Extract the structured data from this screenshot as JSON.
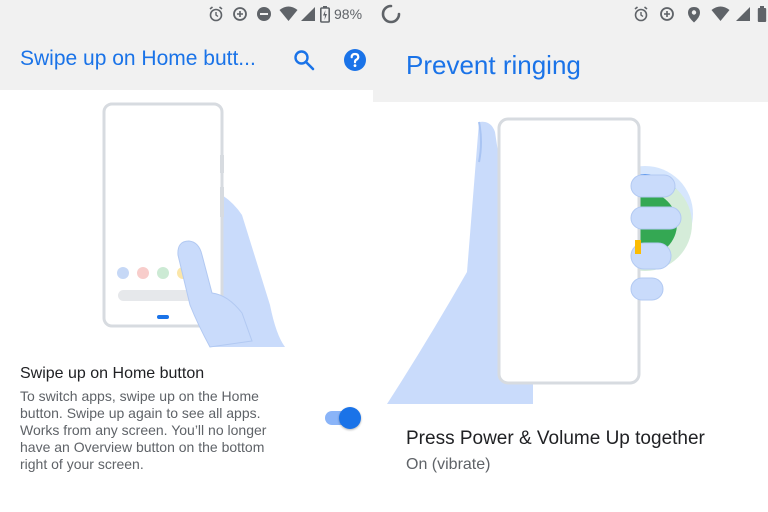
{
  "left_screen": {
    "status_bar": {
      "battery_percent": "98%"
    },
    "app_bar": {
      "title": "Swipe up on Home butt..."
    },
    "setting": {
      "title": "Swipe up on Home button",
      "description_lines": [
        "To switch apps, swipe up on the Home",
        "button. Swipe up again to see all apps.",
        "Works from any screen. You’ll no longer",
        "have an Overview button on the bottom",
        "right of your screen."
      ],
      "enabled": true
    },
    "colors": {
      "accent": "#1a73e8",
      "illustration": "#c9dbfb"
    }
  },
  "right_screen": {
    "app_bar": {
      "title": "Prevent ringing"
    },
    "setting": {
      "title": "Press Power & Volume Up together",
      "summary": "On (vibrate)"
    },
    "colors": {
      "accent": "#1a73e8",
      "green": "#34a853"
    }
  }
}
